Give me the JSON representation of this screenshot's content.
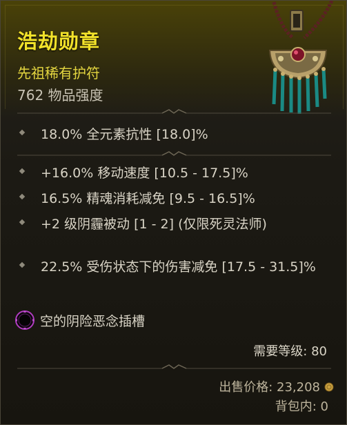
{
  "item": {
    "name": "浩劫勋章",
    "type": "先祖稀有护符",
    "power": "762 物品强度",
    "icon": "amulet-icon"
  },
  "implicit_affixes": [
    "18.0% 全元素抗性 [18.0]%"
  ],
  "affixes": [
    "+16.0% 移动速度 [10.5 - 17.5]%",
    "16.5% 精魂消耗减免 [9.5 - 16.5]%",
    "+2 级阴霾被动 [1 - 2] (仅限死灵法师)",
    "22.5% 受伤状态下的伤害减免 [17.5 - 31.5]%"
  ],
  "socket": {
    "label": "空的阴险恶念插槽",
    "icon": "malignant-socket-icon"
  },
  "requirements": {
    "level": "需要等级: 80"
  },
  "footer": {
    "sell_price": "出售价格: 23,208",
    "in_bag": "背包内: 0",
    "currency_icon": "gold-coin-icon"
  },
  "colors": {
    "name": "#f2e22a",
    "type": "#e4d640",
    "text": "#d9d4c6",
    "socket_ring": "#b03cc0"
  }
}
